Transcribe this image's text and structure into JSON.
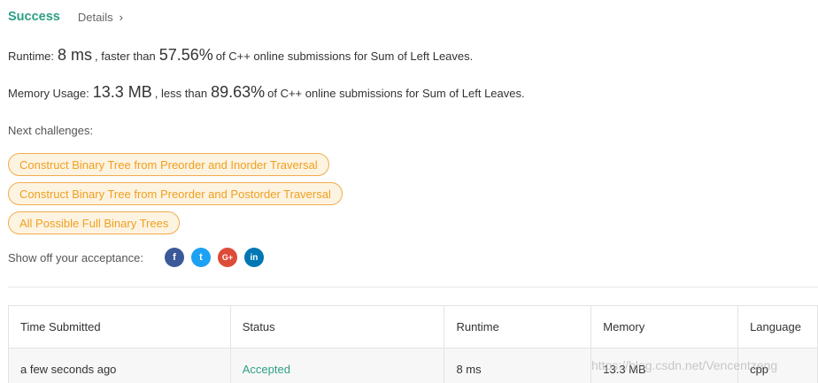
{
  "header": {
    "status": "Success",
    "details": "Details",
    "chevron": "›"
  },
  "runtime": {
    "label": "Runtime:",
    "value": "8 ms",
    "comparison": ", faster than",
    "percent": "57.56%",
    "suffix": "of C++ online submissions for Sum of Left Leaves."
  },
  "memory": {
    "label": "Memory Usage:",
    "value": "13.3 MB",
    "comparison": ", less than",
    "percent": "89.63%",
    "suffix": "of C++ online submissions for Sum of Left Leaves."
  },
  "next": {
    "label": "Next challenges:",
    "items": [
      "Construct Binary Tree from Preorder and Inorder Traversal",
      "Construct Binary Tree from Preorder and Postorder Traversal",
      "All Possible Full Binary Trees"
    ]
  },
  "share": {
    "label": "Show off your acceptance:",
    "icons": [
      "facebook-icon",
      "twitter-icon",
      "google-plus-icon",
      "linkedin-icon"
    ],
    "glyphs": {
      "facebook": "f",
      "twitter": "t",
      "google": "G+",
      "linkedin": "in"
    }
  },
  "table": {
    "headers": [
      "Time Submitted",
      "Status",
      "Runtime",
      "Memory",
      "Language"
    ],
    "rows": [
      [
        "a few seconds ago",
        "Accepted",
        "8 ms",
        "13.3 MB",
        "cpp"
      ]
    ]
  },
  "watermark": "https://blog.csdn.net/Vencentzeng",
  "colors": {
    "success": "#2e9f85",
    "tag_border": "#f0ad4e",
    "tag_text": "#f0a020",
    "facebook": "#3b5998",
    "twitter": "#1da1f2",
    "google": "#dd4b39",
    "linkedin": "#0077b5"
  }
}
